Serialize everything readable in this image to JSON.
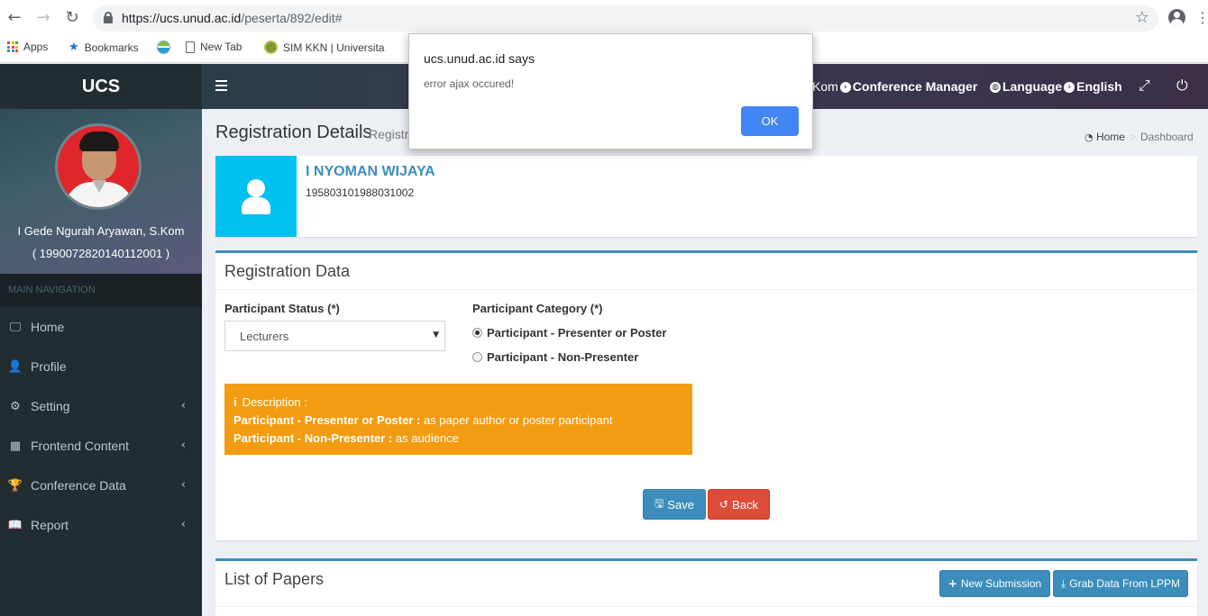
{
  "browser": {
    "url_host": "https://ucs.unud.ac.id",
    "url_path": "/peserta/892/edit#",
    "bookmarks": [
      {
        "label": "Apps",
        "icon": "apps-icon"
      },
      {
        "label": "Bookmarks",
        "icon": "star-icon"
      },
      {
        "label": "",
        "icon": "globe-icon"
      },
      {
        "label": "New Tab",
        "icon": "page-icon"
      },
      {
        "label": "SIM KKN | Universita",
        "icon": "university-icon"
      }
    ]
  },
  "header": {
    "logo": "UCS",
    "nav_partial": "Kom",
    "nav_conference": "Conference Manager",
    "nav_language_label": "Language",
    "nav_language_value": "English"
  },
  "sidebar": {
    "user_name": "I Gede Ngurah Aryawan, S.Kom",
    "user_id": "( 199007282014011200​1 )",
    "nav_header": "MAIN NAVIGATION",
    "items": [
      {
        "label": "Home",
        "icon": "desktop-icon",
        "has_children": false
      },
      {
        "label": "Profile",
        "icon": "user-icon",
        "has_children": false
      },
      {
        "label": "Setting",
        "icon": "gears-icon",
        "has_children": true
      },
      {
        "label": "Frontend Content",
        "icon": "building-icon",
        "has_children": true
      },
      {
        "label": "Conference Data",
        "icon": "trophy-icon",
        "has_children": true
      },
      {
        "label": "Report",
        "icon": "book-icon",
        "has_children": true
      }
    ]
  },
  "page": {
    "title": "Registration Details",
    "subtitle": "Registr",
    "breadcrumb_home": "Home",
    "breadcrumb_current": "Dashboard"
  },
  "profile": {
    "name": "I NYOMAN WIJAYA",
    "nip": "195803101988031002"
  },
  "registration": {
    "title": "Registration Data",
    "status_label": "Participant Status (*)",
    "status_value": "Lecturers",
    "category_label": "Participant Category (*)",
    "category_options": [
      {
        "label": "Participant - Presenter or Poster",
        "selected": true
      },
      {
        "label": "Participant - Non-Presenter",
        "selected": false
      }
    ],
    "description_title": "Description :",
    "desc1_term": "Participant - Presenter or Poster :",
    "desc1_text": " as paper author or poster participant",
    "desc2_term": "Participant - Non-Presenter :",
    "desc2_text": " as audience",
    "save_label": "Save",
    "back_label": "Back"
  },
  "papers": {
    "title": "List of Papers",
    "new_submission_label": "New Submission",
    "grab_data_label": "Grab Data From LPPM"
  },
  "dialog": {
    "title": "ucs.unud.ac.id says",
    "message": "error ajax occured!",
    "ok_label": "OK"
  },
  "colors": {
    "sidebar_bg": "#222d32",
    "accent_blue": "#3c8dbc",
    "info_cyan": "#00c0ef",
    "warning_orange": "#f39c12",
    "danger_red": "#dd4b39",
    "dialog_button": "#4285f4"
  }
}
